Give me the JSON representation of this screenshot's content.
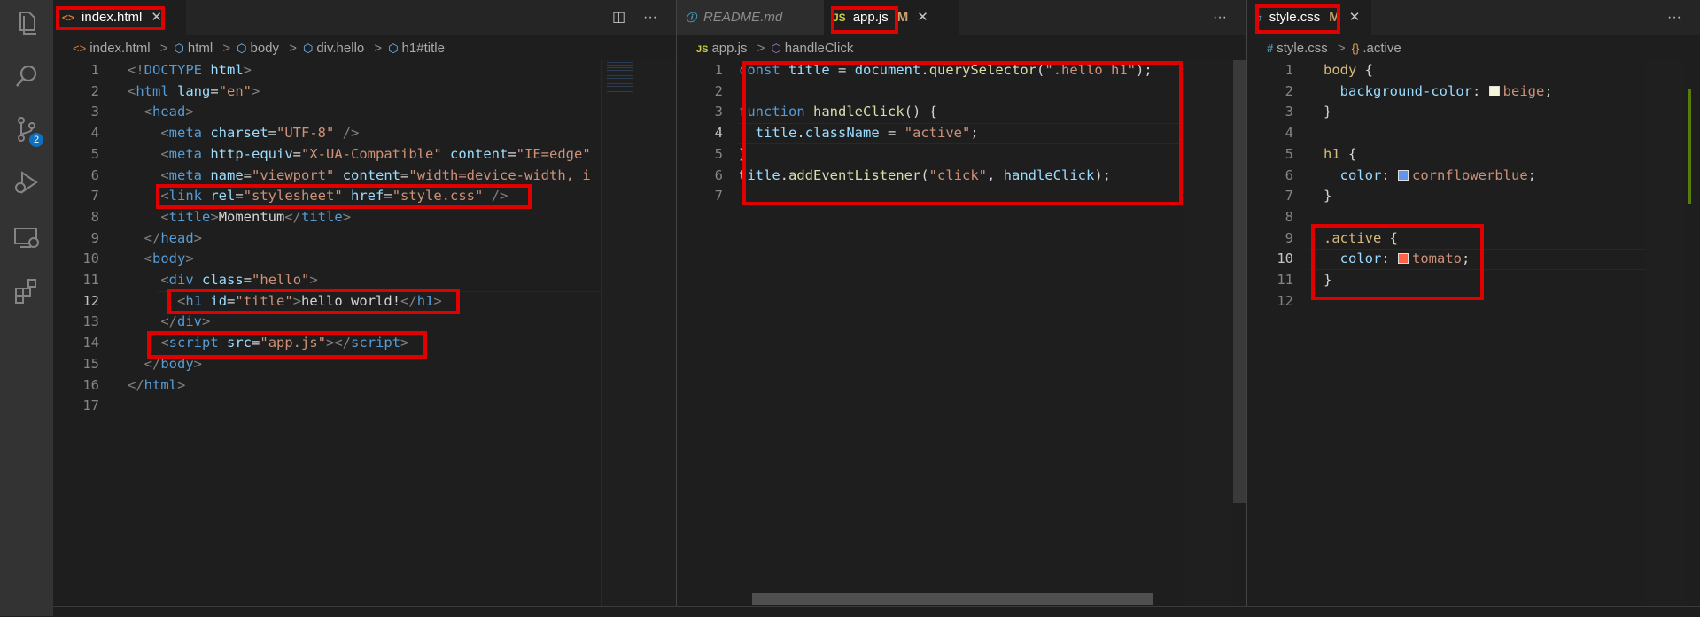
{
  "activity_bar": {
    "scm_badge": "2"
  },
  "pane1": {
    "tab": {
      "icon": "<>",
      "label": "index.html",
      "close": "✕"
    },
    "actions": {
      "split": "◫",
      "more": "···"
    },
    "breadcrumb": [
      "index.html",
      "html",
      "body",
      "div.hello",
      "h1#title"
    ],
    "lines": [
      {
        "n": "1",
        "segs": [
          [
            "t-tag",
            "<!"
          ],
          [
            "t-el",
            "DOCTYPE"
          ],
          [
            "t-txt",
            " "
          ],
          [
            "t-attr",
            "html"
          ],
          [
            "t-tag",
            ">"
          ]
        ]
      },
      {
        "n": "2",
        "segs": [
          [
            "t-tag",
            "<"
          ],
          [
            "t-el",
            "html"
          ],
          [
            "t-txt",
            " "
          ],
          [
            "t-attr",
            "lang"
          ],
          [
            "t-txt",
            "="
          ],
          [
            "t-str",
            "\"en\""
          ],
          [
            "t-tag",
            ">"
          ]
        ]
      },
      {
        "n": "3",
        "segs": [
          [
            "t-txt",
            "  "
          ],
          [
            "t-tag",
            "<"
          ],
          [
            "t-el",
            "head"
          ],
          [
            "t-tag",
            ">"
          ]
        ]
      },
      {
        "n": "4",
        "segs": [
          [
            "t-txt",
            "    "
          ],
          [
            "t-tag",
            "<"
          ],
          [
            "t-el",
            "meta"
          ],
          [
            "t-txt",
            " "
          ],
          [
            "t-attr",
            "charset"
          ],
          [
            "t-txt",
            "="
          ],
          [
            "t-str",
            "\"UTF-8\""
          ],
          [
            "t-txt",
            " "
          ],
          [
            "t-tag",
            "/>"
          ]
        ]
      },
      {
        "n": "5",
        "segs": [
          [
            "t-txt",
            "    "
          ],
          [
            "t-tag",
            "<"
          ],
          [
            "t-el",
            "meta"
          ],
          [
            "t-txt",
            " "
          ],
          [
            "t-attr",
            "http-equiv"
          ],
          [
            "t-txt",
            "="
          ],
          [
            "t-str",
            "\"X-UA-Compatible\""
          ],
          [
            "t-txt",
            " "
          ],
          [
            "t-attr",
            "content"
          ],
          [
            "t-txt",
            "="
          ],
          [
            "t-str",
            "\"IE=edge\""
          ]
        ]
      },
      {
        "n": "6",
        "segs": [
          [
            "t-txt",
            "    "
          ],
          [
            "t-tag",
            "<"
          ],
          [
            "t-el",
            "meta"
          ],
          [
            "t-txt",
            " "
          ],
          [
            "t-attr",
            "name"
          ],
          [
            "t-txt",
            "="
          ],
          [
            "t-str",
            "\"viewport\""
          ],
          [
            "t-txt",
            " "
          ],
          [
            "t-attr",
            "content"
          ],
          [
            "t-txt",
            "="
          ],
          [
            "t-str",
            "\"width=device-width, i"
          ]
        ]
      },
      {
        "n": "7",
        "segs": [
          [
            "t-txt",
            "    "
          ],
          [
            "t-tag",
            "<"
          ],
          [
            "t-el",
            "link"
          ],
          [
            "t-txt",
            " "
          ],
          [
            "t-attr",
            "rel"
          ],
          [
            "t-txt",
            "="
          ],
          [
            "t-str",
            "\"stylesheet\""
          ],
          [
            "t-txt",
            " "
          ],
          [
            "t-attr",
            "href"
          ],
          [
            "t-txt",
            "="
          ],
          [
            "t-str",
            "\"style.css\""
          ],
          [
            "t-txt",
            " "
          ],
          [
            "t-tag",
            "/>"
          ]
        ]
      },
      {
        "n": "8",
        "segs": [
          [
            "t-txt",
            "    "
          ],
          [
            "t-tag",
            "<"
          ],
          [
            "t-el",
            "title"
          ],
          [
            "t-tag",
            ">"
          ],
          [
            "t-txt",
            "Momentum"
          ],
          [
            "t-tag",
            "</"
          ],
          [
            "t-el",
            "title"
          ],
          [
            "t-tag",
            ">"
          ]
        ]
      },
      {
        "n": "9",
        "segs": [
          [
            "t-txt",
            "  "
          ],
          [
            "t-tag",
            "</"
          ],
          [
            "t-el",
            "head"
          ],
          [
            "t-tag",
            ">"
          ]
        ]
      },
      {
        "n": "10",
        "segs": [
          [
            "t-txt",
            "  "
          ],
          [
            "t-tag",
            "<"
          ],
          [
            "t-el",
            "body"
          ],
          [
            "t-tag",
            ">"
          ]
        ]
      },
      {
        "n": "11",
        "segs": [
          [
            "t-txt",
            "    "
          ],
          [
            "t-tag",
            "<"
          ],
          [
            "t-el",
            "div"
          ],
          [
            "t-txt",
            " "
          ],
          [
            "t-attr",
            "class"
          ],
          [
            "t-txt",
            "="
          ],
          [
            "t-str",
            "\"hello\""
          ],
          [
            "t-tag",
            ">"
          ]
        ]
      },
      {
        "n": "12",
        "segs": [
          [
            "t-txt",
            "      "
          ],
          [
            "t-tag",
            "<"
          ],
          [
            "t-el",
            "h1"
          ],
          [
            "t-txt",
            " "
          ],
          [
            "t-attr",
            "id"
          ],
          [
            "t-txt",
            "="
          ],
          [
            "t-str",
            "\"title\""
          ],
          [
            "t-tag",
            ">"
          ],
          [
            "t-txt",
            "hello world!"
          ],
          [
            "t-tag",
            "</"
          ],
          [
            "t-el",
            "h1"
          ],
          [
            "t-tag",
            ">"
          ]
        ]
      },
      {
        "n": "13",
        "segs": [
          [
            "t-txt",
            "    "
          ],
          [
            "t-tag",
            "</"
          ],
          [
            "t-el",
            "div"
          ],
          [
            "t-tag",
            ">"
          ]
        ]
      },
      {
        "n": "14",
        "segs": [
          [
            "t-txt",
            "    "
          ],
          [
            "t-tag",
            "<"
          ],
          [
            "t-el",
            "script"
          ],
          [
            "t-txt",
            " "
          ],
          [
            "t-attr",
            "src"
          ],
          [
            "t-txt",
            "="
          ],
          [
            "t-str",
            "\"app.js\""
          ],
          [
            "t-tag",
            ">"
          ],
          [
            "t-tag",
            "</"
          ],
          [
            "t-el",
            "script"
          ],
          [
            "t-tag",
            ">"
          ]
        ]
      },
      {
        "n": "15",
        "segs": [
          [
            "t-txt",
            "  "
          ],
          [
            "t-tag",
            "</"
          ],
          [
            "t-el",
            "body"
          ],
          [
            "t-tag",
            ">"
          ]
        ]
      },
      {
        "n": "16",
        "segs": [
          [
            "t-tag",
            "</"
          ],
          [
            "t-el",
            "html"
          ],
          [
            "t-tag",
            ">"
          ]
        ]
      },
      {
        "n": "17",
        "segs": []
      }
    ]
  },
  "pane2": {
    "tabs": [
      {
        "icon": "ⓘ",
        "label": "README.md"
      },
      {
        "icon": "JS",
        "label": "app.js",
        "modified": "M",
        "close": "✕"
      }
    ],
    "more": "···",
    "breadcrumb": [
      "app.js",
      "handleClick"
    ],
    "lines": [
      {
        "n": "1",
        "segs": [
          [
            "t-kw",
            "const"
          ],
          [
            "t-txt",
            " "
          ],
          [
            "t-var",
            "title"
          ],
          [
            "t-txt",
            " = "
          ],
          [
            "t-var",
            "document"
          ],
          [
            "t-txt",
            "."
          ],
          [
            "t-fn",
            "querySelector"
          ],
          [
            "t-txt",
            "("
          ],
          [
            "t-str",
            "\".hello h1\""
          ],
          [
            "t-txt",
            ");"
          ]
        ]
      },
      {
        "n": "2",
        "segs": []
      },
      {
        "n": "3",
        "segs": [
          [
            "t-kw",
            "function"
          ],
          [
            "t-txt",
            " "
          ],
          [
            "t-fn",
            "handleClick"
          ],
          [
            "t-txt",
            "() {"
          ]
        ]
      },
      {
        "n": "4",
        "segs": [
          [
            "t-txt",
            "  "
          ],
          [
            "t-var",
            "title"
          ],
          [
            "t-txt",
            "."
          ],
          [
            "t-var",
            "className"
          ],
          [
            "t-txt",
            " = "
          ],
          [
            "t-str",
            "\"active\""
          ],
          [
            "t-txt",
            ";"
          ]
        ]
      },
      {
        "n": "5",
        "segs": [
          [
            "t-txt",
            "}"
          ]
        ]
      },
      {
        "n": "6",
        "segs": [
          [
            "t-var",
            "title"
          ],
          [
            "t-txt",
            "."
          ],
          [
            "t-fn",
            "addEventListener"
          ],
          [
            "t-txt",
            "("
          ],
          [
            "t-str",
            "\"click\""
          ],
          [
            "t-txt",
            ", "
          ],
          [
            "t-var",
            "handleClick"
          ],
          [
            "t-txt",
            ");"
          ]
        ]
      },
      {
        "n": "7",
        "segs": []
      }
    ]
  },
  "pane3": {
    "tab": {
      "icon": "#",
      "label": "style.css",
      "modified": "M",
      "close": "✕"
    },
    "more": "···",
    "breadcrumb": [
      "style.css",
      ".active"
    ],
    "lines": [
      {
        "n": "1",
        "segs": [
          [
            "t-sel",
            "body"
          ],
          [
            "t-txt",
            " {"
          ]
        ]
      },
      {
        "n": "2",
        "segs": [
          [
            "t-txt",
            "  "
          ],
          [
            "t-prop",
            "background-color"
          ],
          [
            "t-txt",
            ": "
          ],
          [
            "swatch",
            "#f5f5dc"
          ],
          [
            "t-val",
            "beige"
          ],
          [
            "t-txt",
            ";"
          ]
        ]
      },
      {
        "n": "3",
        "segs": [
          [
            "t-txt",
            "}"
          ]
        ]
      },
      {
        "n": "4",
        "segs": []
      },
      {
        "n": "5",
        "segs": [
          [
            "t-sel",
            "h1"
          ],
          [
            "t-txt",
            " {"
          ]
        ]
      },
      {
        "n": "6",
        "segs": [
          [
            "t-txt",
            "  "
          ],
          [
            "t-prop",
            "color"
          ],
          [
            "t-txt",
            ": "
          ],
          [
            "swatch",
            "#6495ed"
          ],
          [
            "t-val",
            "cornflowerblue"
          ],
          [
            "t-txt",
            ";"
          ]
        ]
      },
      {
        "n": "7",
        "segs": [
          [
            "t-txt",
            "}"
          ]
        ]
      },
      {
        "n": "8",
        "segs": []
      },
      {
        "n": "9",
        "segs": [
          [
            "t-sel",
            ".active"
          ],
          [
            "t-txt",
            " {"
          ]
        ]
      },
      {
        "n": "10",
        "segs": [
          [
            "t-txt",
            "  "
          ],
          [
            "t-prop",
            "color"
          ],
          [
            "t-txt",
            ": "
          ],
          [
            "swatch",
            "#ff6347"
          ],
          [
            "t-val",
            "tomato"
          ],
          [
            "t-txt",
            ";"
          ]
        ]
      },
      {
        "n": "11",
        "segs": [
          [
            "t-txt",
            "}"
          ]
        ]
      },
      {
        "n": "12",
        "segs": []
      }
    ]
  },
  "colors": {
    "highlight_box": "#e00000",
    "accent": "#0e70c0"
  }
}
